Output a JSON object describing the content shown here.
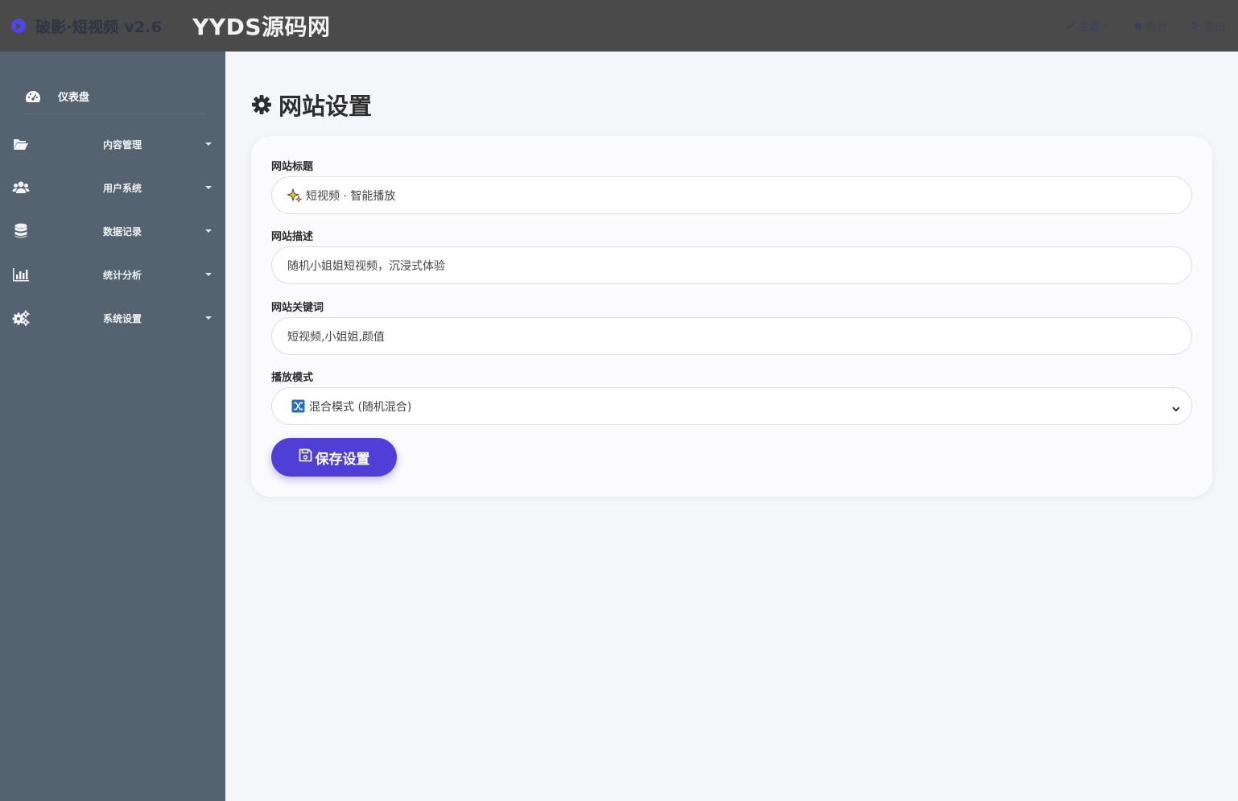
{
  "header": {
    "brand": "破影·短视频 v2.6",
    "watermark": "YYDS源码网",
    "actions": [
      {
        "label": "主题",
        "icon": "pencil-icon"
      },
      {
        "label": "前台",
        "icon": "home-icon"
      },
      {
        "label": "退出",
        "icon": "logout-icon"
      }
    ]
  },
  "sidebar": {
    "dashboard": {
      "label": "仪表盘",
      "icon": "dashboard-gauge-icon"
    },
    "items": [
      {
        "label": "内容管理",
        "icon": "folder-open-icon"
      },
      {
        "label": "用户系统",
        "icon": "users-icon"
      },
      {
        "label": "数据记录",
        "icon": "database-icon"
      },
      {
        "label": "统计分析",
        "icon": "bar-chart-icon"
      },
      {
        "label": "系统设置",
        "icon": "gears-icon"
      }
    ]
  },
  "page": {
    "title": "网站设置",
    "icon": "gear-icon"
  },
  "form": {
    "site_title": {
      "label": "网站标题",
      "value": "短视频 · 智能播放",
      "emoji": "sparkles"
    },
    "site_desc": {
      "label": "网站描述",
      "value": "随机小姐姐短视频，沉浸式体验"
    },
    "site_keywords": {
      "label": "网站关键词",
      "value": "短视频,小姐姐,颜值"
    },
    "play_mode": {
      "label": "播放模式",
      "value": "混合模式 (随机混合)",
      "emoji": "shuffle"
    },
    "save_label": "保存设置"
  },
  "colors": {
    "topbar": "#4a4a4a",
    "sidebar": "#556270",
    "accent": "#4f3fd6",
    "background": "#f5f6fa"
  }
}
